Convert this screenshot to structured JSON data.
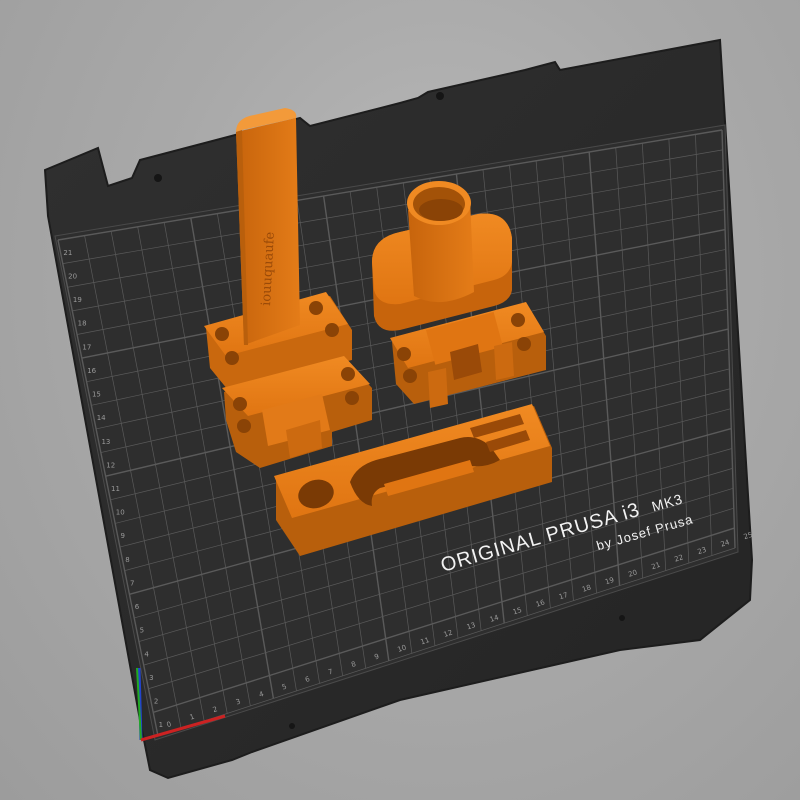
{
  "bed": {
    "title_line1": "ORIGINAL PRUSA i3",
    "title_model": "MK3",
    "title_line2": "by Josef Prusa",
    "bed_color": "#2b2b2b",
    "grid_color": "#5a5a5a",
    "background_color": "#a9a9a9",
    "axis_labels_bottom": [
      "0",
      "1",
      "2",
      "3",
      "4",
      "5",
      "6",
      "7",
      "8",
      "9",
      "10",
      "11",
      "12",
      "13",
      "14",
      "15",
      "16",
      "17",
      "18",
      "19",
      "20",
      "21",
      "22",
      "23",
      "24",
      "25"
    ],
    "axis_labels_left": [
      "1",
      "2",
      "3",
      "4",
      "5",
      "6",
      "7",
      "8",
      "9",
      "10",
      "11",
      "12",
      "13",
      "14",
      "15",
      "16",
      "17",
      "18",
      "19",
      "20",
      "21"
    ]
  },
  "model": {
    "color": "#e37c18",
    "shade_color": "#b85f0c",
    "embossed_text": "iouuquaufe"
  },
  "axes": {
    "x_color": "#cc2222",
    "y_color": "#22aa22",
    "z_color": "#2244cc"
  }
}
